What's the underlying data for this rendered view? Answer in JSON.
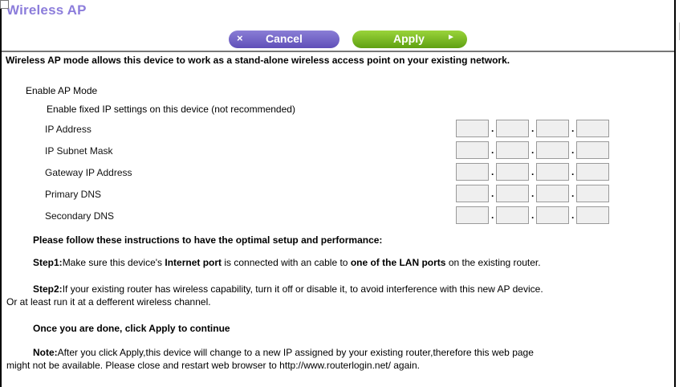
{
  "page": {
    "title": "Wireless AP"
  },
  "toolbar": {
    "cancel_icon": "×",
    "cancel_label": "Cancel",
    "apply_label": "Apply",
    "apply_icon": "►"
  },
  "description": "Wireless AP mode allows this device to work as a stand-alone wireless access point on your existing network.",
  "options": {
    "enable_ap_mode": {
      "label": "Enable AP Mode",
      "checked": true
    },
    "enable_fixed_ip": {
      "label": "Enable fixed IP settings on this device (not recommended)",
      "checked": false
    }
  },
  "fields": [
    {
      "label": "IP Address",
      "octets": [
        "",
        "",
        "",
        ""
      ]
    },
    {
      "label": "IP Subnet Mask",
      "octets": [
        "",
        "",
        "",
        ""
      ]
    },
    {
      "label": "Gateway IP Address",
      "octets": [
        "",
        "",
        "",
        ""
      ]
    },
    {
      "label": "Primary DNS",
      "octets": [
        "",
        "",
        "",
        ""
      ]
    },
    {
      "label": "Secondary DNS",
      "octets": [
        "",
        "",
        "",
        ""
      ]
    }
  ],
  "instructions": {
    "heading": "Please follow these instructions to have the optimal setup and performance:",
    "step1_prefix": "Step1:",
    "step1_a": "Make sure this device's ",
    "step1_b": "Internet port",
    "step1_c": " is connected with an cable to ",
    "step1_d": "one of the LAN ports",
    "step1_e": " on the existing router.",
    "step2_prefix": "Step2:",
    "step2_line1": "If your existing router has wireless capability, turn it off or disable it, to avoid interference with this new AP device.",
    "step2_line2": "Or at least run it at a defferent wireless channel.",
    "done": "Once you are done, click Apply to continue",
    "note_prefix": "Note:",
    "note_line1": "After you click Apply,this device will change to a new IP assigned by your existing router,therefore this web page",
    "note_line2": "might not be available. Please close and restart web browser to http://www.routerlogin.net/ again."
  },
  "colors": {
    "title": "#8c7ddb",
    "cancel_button": "#6e60c4",
    "apply_button": "#7cba24"
  }
}
